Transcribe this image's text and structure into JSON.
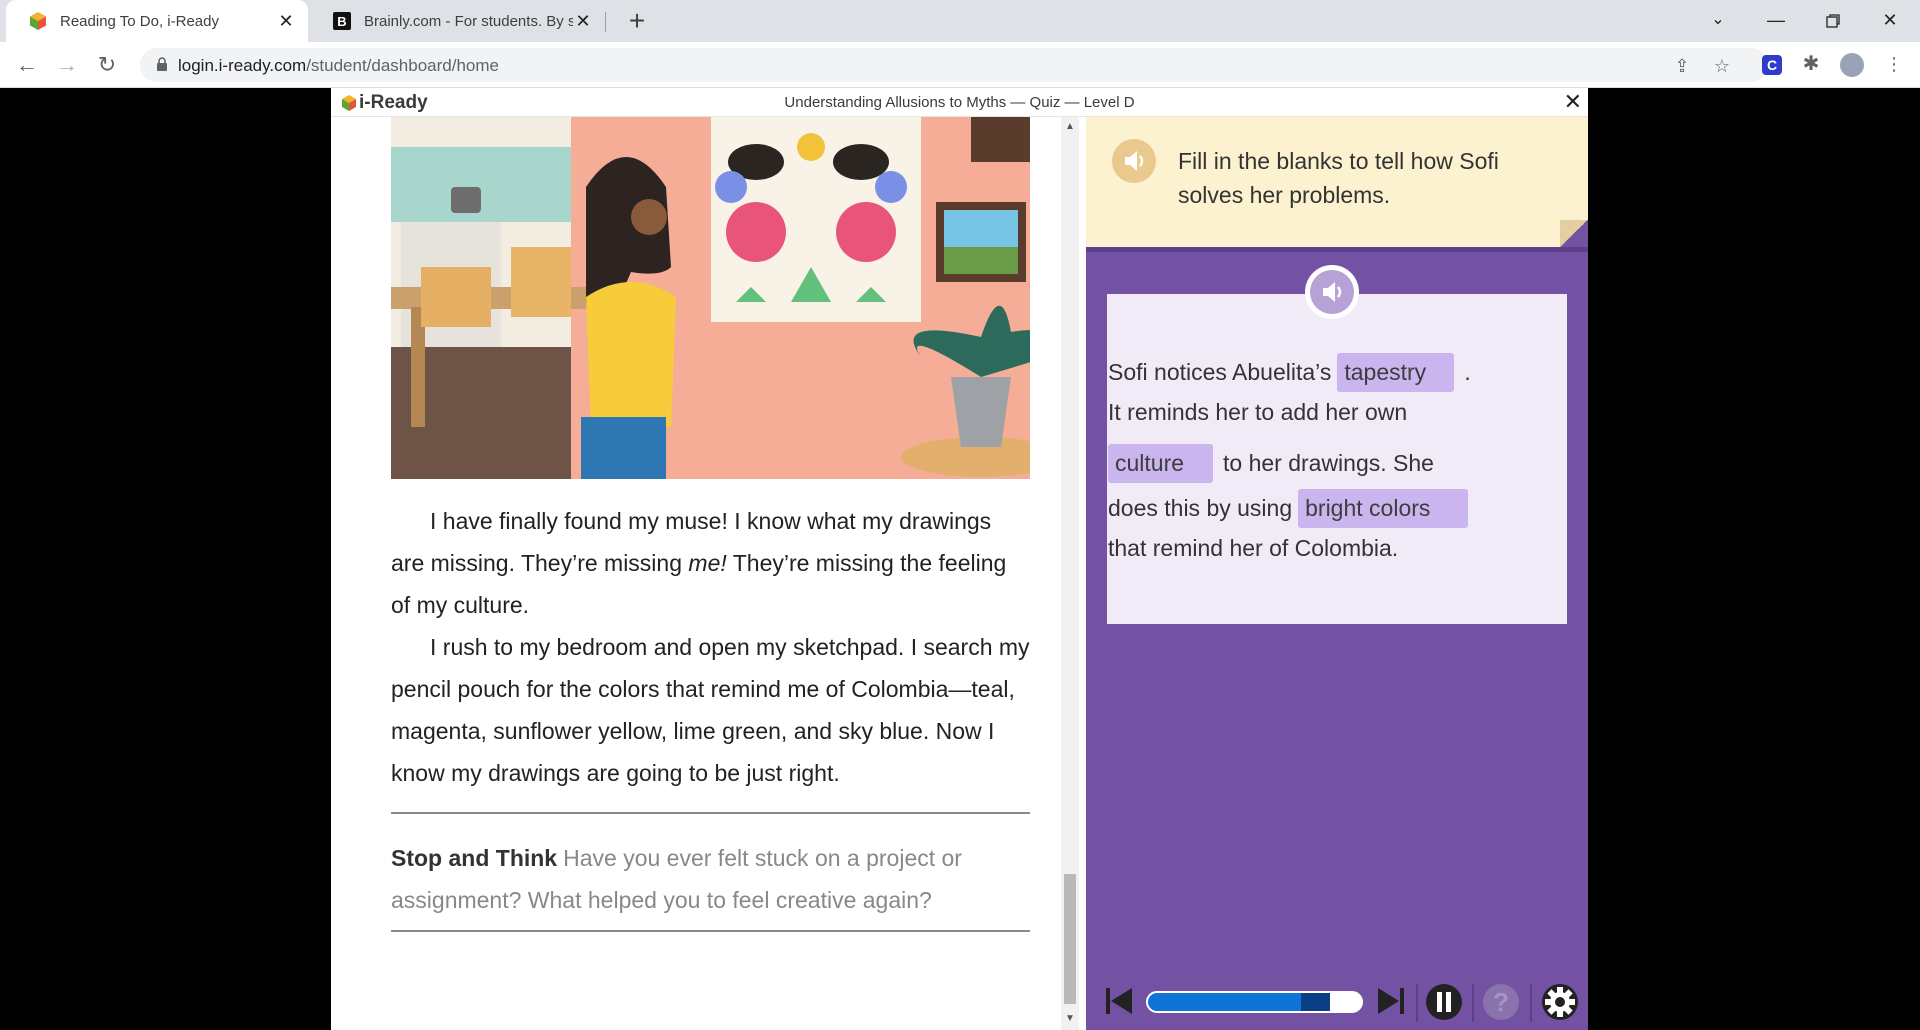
{
  "browser": {
    "tabs": [
      {
        "title": "Reading To Do, i-Ready",
        "active": true,
        "favicon": "iready-cube-icon"
      },
      {
        "title": "Brainly.com - For students. By stu",
        "active": false,
        "favicon": "brainly-b-icon"
      }
    ],
    "url_host": "login.i-ready.com",
    "url_path": "/student/dashboard/home"
  },
  "app": {
    "logo_text": "i-Ready",
    "title": "Understanding Allusions to Myths — Quiz — Level D"
  },
  "passage": {
    "p1_before": "I have finally found my muse! I know what my drawings are missing. They’re missing ",
    "p1_em": "me!",
    "p1_after": " They’re missing the feeling of my culture.",
    "p2": "I rush to my bedroom and open my sketchpad. I search my pencil pouch for the colors that remind me of Colombia—teal, magenta, sunflower yellow, lime green, and sky blue. Now I know my drawings are going to be just right.",
    "stop_label": "Stop and Think",
    "stop_text": "Have you ever felt stuck on a project or assignment? What helped you to feel creative again?"
  },
  "question": {
    "prompt": "Fill in the blanks to tell how Sofi solves her problems.",
    "l1_text": "Sofi notices Abuelita’s",
    "blank1": "tapestry",
    "l1_end": ".",
    "l2_text": "It reminds her to add her own",
    "blank2": "culture",
    "l3_text": "to her drawings. She",
    "l4_text": "does this by using",
    "blank3": "bright colors",
    "l5_text": "that remind her of Colombia."
  },
  "player": {
    "progress": 0.72,
    "colors": {
      "track": "#ffffff",
      "fill": "#0f74d8",
      "marker": "#0a3f86"
    }
  },
  "colors": {
    "question_bg": "#7452a3",
    "prompt_bg": "#fdf2d0",
    "blank_bg": "#cbb5ef"
  }
}
